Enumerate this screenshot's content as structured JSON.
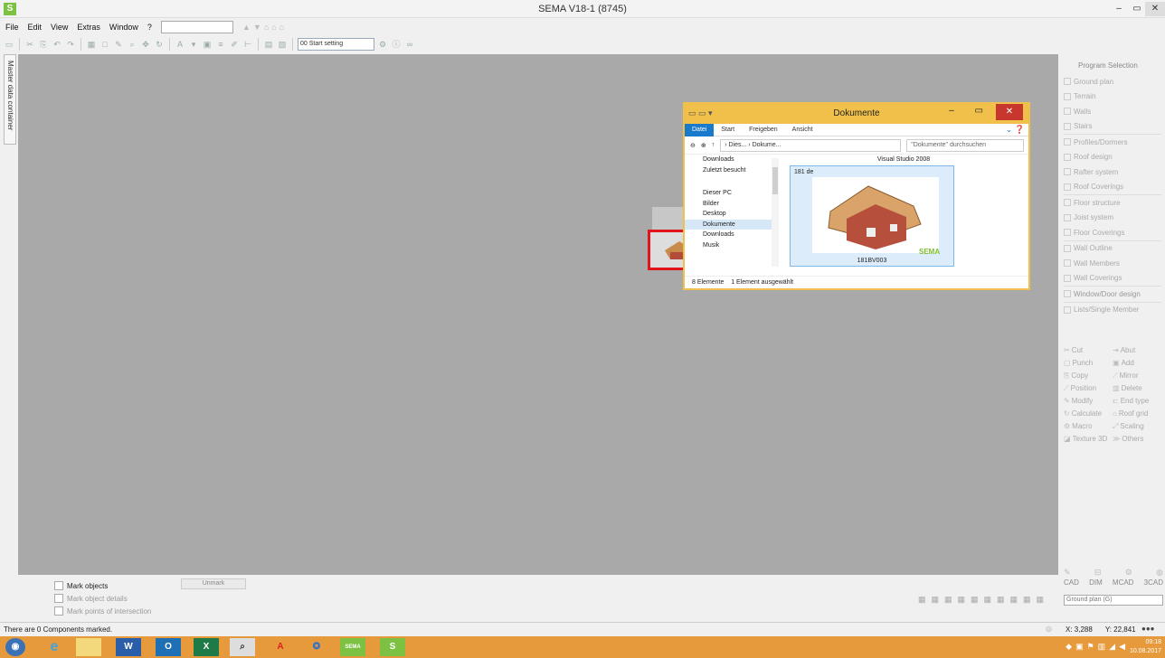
{
  "window": {
    "title": "SEMA V18-1 (8745)",
    "app_icon": "S",
    "min": "–",
    "max": "▭",
    "close": "✕"
  },
  "menu": [
    "File",
    "Edit",
    "View",
    "Extras",
    "Window",
    "?"
  ],
  "toolbar": {
    "start_setting": "00 Start setting"
  },
  "left_tab": "Master data container",
  "right_panel": {
    "header": "Program Selection",
    "items": [
      "Ground plan",
      "Terrain",
      "Walls",
      "Stairs",
      "Profiles/Dormers",
      "Roof design",
      "Rafter system",
      "Roof Coverings",
      "Floor structure",
      "Joist system",
      "Floor Coverings",
      "Wall Outline",
      "Wall Members",
      "Wall Coverings",
      "Window/Door design",
      "Lists/Single Member"
    ],
    "commands": [
      "Cut",
      "Abut",
      "Punch",
      "Add",
      "Copy",
      "Mirror",
      "Position",
      "Delete",
      "Modify",
      "End type",
      "Calculate",
      "Roof grid",
      "Macro",
      "Scaling",
      "Texture 3D",
      "Others"
    ],
    "cad_modes": [
      "CAD",
      "DIM",
      "MCAD",
      "3CAD"
    ],
    "view_select": "Ground plan (G)"
  },
  "bottom": {
    "mark_objects": "Mark objects",
    "mark_details": "Mark object details",
    "mark_points": "Mark points of intersection",
    "unmark": "Unmark"
  },
  "status": {
    "text": "There are 0 Components marked.",
    "x": "X: 3,288",
    "y": "Y: 22,841"
  },
  "explorer": {
    "title": "Dokumente",
    "tabs": [
      "Datei",
      "Start",
      "Freigeben",
      "Ansicht"
    ],
    "address": "› Dies... › Dokume...",
    "search": "\"Dokumente\" durchsuchen",
    "nav": [
      "Downloads",
      "Zuletzt besucht",
      "",
      "Dieser PC",
      "Bilder",
      "Desktop",
      "Dokumente",
      "Downloads",
      "Musik"
    ],
    "group": "Visual Studio 2008",
    "item_label": "181 de",
    "item_caption": "181BV003",
    "brand": "SEMA",
    "status_count": "8 Elemente",
    "status_sel": "1 Element ausgewählt"
  },
  "taskbar": {
    "sema_label": "SEMA",
    "time": "09:18",
    "date": "10.08.2017"
  }
}
